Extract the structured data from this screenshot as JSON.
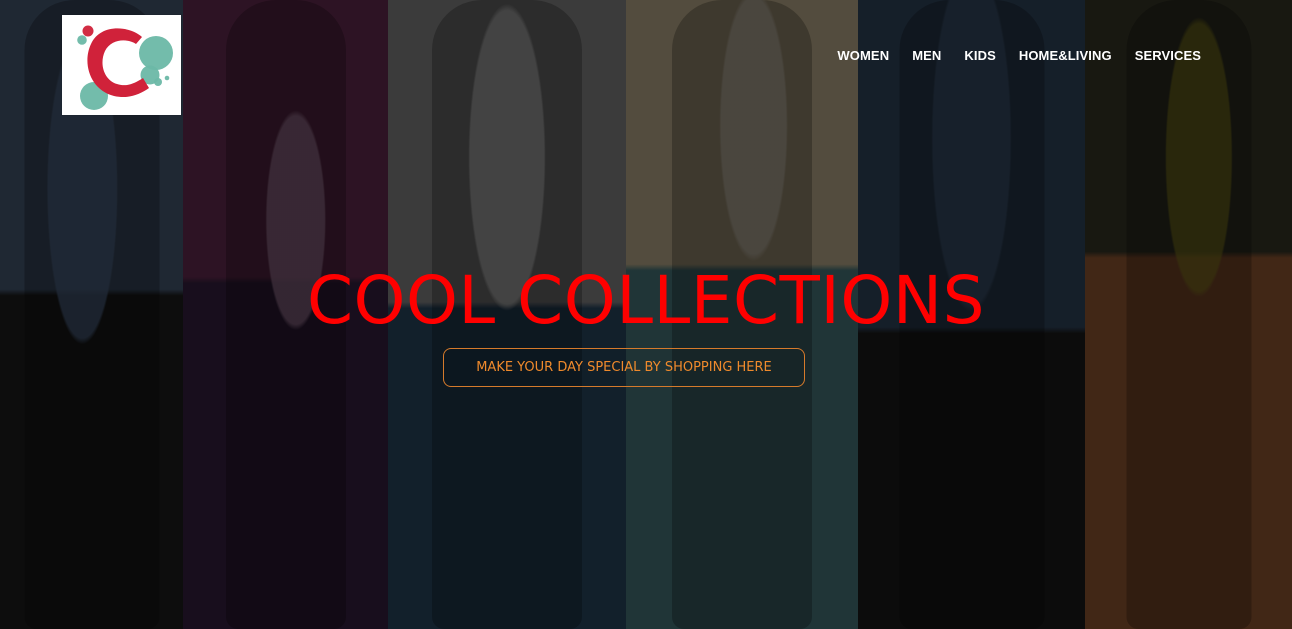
{
  "brand": {
    "logo_icon": "cool-collections-logo-icon",
    "logo_letter": "C"
  },
  "nav": {
    "items": [
      {
        "label": "WOMEN"
      },
      {
        "label": "MEN"
      },
      {
        "label": "KIDS"
      },
      {
        "label": "HOME&LIVING"
      },
      {
        "label": "SERVICES"
      }
    ]
  },
  "hero": {
    "title": "COOL COLLECTIONS",
    "cta_label": "MAKE YOUR DAY SPECIAL BY SHOPPING HERE"
  },
  "colors": {
    "title": "#ff0000",
    "cta": "#ef8a2c",
    "nav": "#ffffff",
    "logo_primary": "#d0223a",
    "logo_secondary": "#6bb8a7"
  }
}
